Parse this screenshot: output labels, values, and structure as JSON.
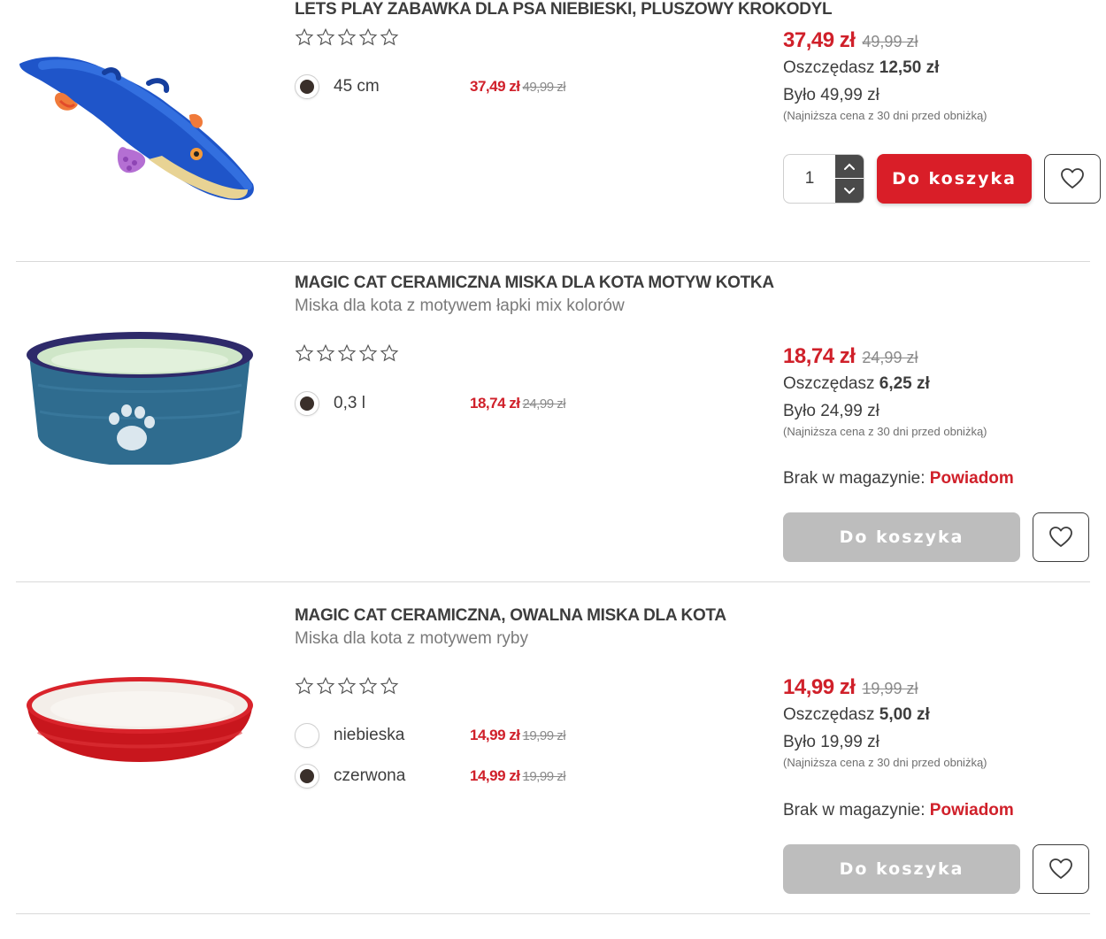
{
  "products": [
    {
      "title": "LETS PLAY ZABAWKA DLA PSA NIEBIESKI, PLUSZOWY KROKODYL",
      "subtitle": "",
      "rating": 0,
      "image_icon": "crocodile-toy-image",
      "variants": [
        {
          "label": "45 cm",
          "price": "37,49 zł",
          "old_price": "49,99 zł",
          "selected": true
        }
      ],
      "price": "37,49 zł",
      "old_price": "49,99 zł",
      "save_label": "Oszczędasz",
      "save_amount": "12,50 zł",
      "was": "Było 49,99 zł",
      "lowest_note": "(Najniższa cena z 30 dni przed obniżką)",
      "quantity": "1",
      "cart_label": "Do koszyka",
      "in_stock": true
    },
    {
      "title": "MAGIC CAT CERAMICZNA MISKA DLA KOTA MOTYW KOTKA",
      "subtitle": "Miska dla kota z motywem łapki mix kolorów",
      "rating": 0,
      "image_icon": "blue-cat-bowl-image",
      "variants": [
        {
          "label": "0,3 l",
          "price": "18,74 zł",
          "old_price": "24,99 zł",
          "selected": true
        }
      ],
      "price": "18,74 zł",
      "old_price": "24,99 zł",
      "save_label": "Oszczędasz",
      "save_amount": "6,25 zł",
      "was": "Było 24,99 zł",
      "lowest_note": "(Najniższa cena z 30 dni przed obniżką)",
      "stock_label": "Brak w magazynie:",
      "notify_label": "Powiadom",
      "cart_label": "Do koszyka",
      "in_stock": false
    },
    {
      "title": "MAGIC CAT CERAMICZNA, OWALNA MISKA DLA KOTA",
      "subtitle": "Miska dla kota z motywem ryby",
      "rating": 0,
      "image_icon": "red-oval-bowl-image",
      "variants": [
        {
          "label": "niebieska",
          "price": "14,99 zł",
          "old_price": "19,99 zł",
          "selected": false
        },
        {
          "label": "czerwona",
          "price": "14,99 zł",
          "old_price": "19,99 zł",
          "selected": true
        }
      ],
      "price": "14,99 zł",
      "old_price": "19,99 zł",
      "save_label": "Oszczędasz",
      "save_amount": "5,00 zł",
      "was": "Było 19,99 zł",
      "lowest_note": "(Najniższa cena z 30 dni przed obniżką)",
      "stock_label": "Brak w magazynie:",
      "notify_label": "Powiadom",
      "cart_label": "Do koszyka",
      "in_stock": false
    }
  ],
  "colors": {
    "accent_red": "#d91e28",
    "price_red": "#d0202a",
    "disabled_grey": "#bdbdbd",
    "text_dark": "#3d3d3d",
    "selected_dot": "#3a2f2a"
  }
}
